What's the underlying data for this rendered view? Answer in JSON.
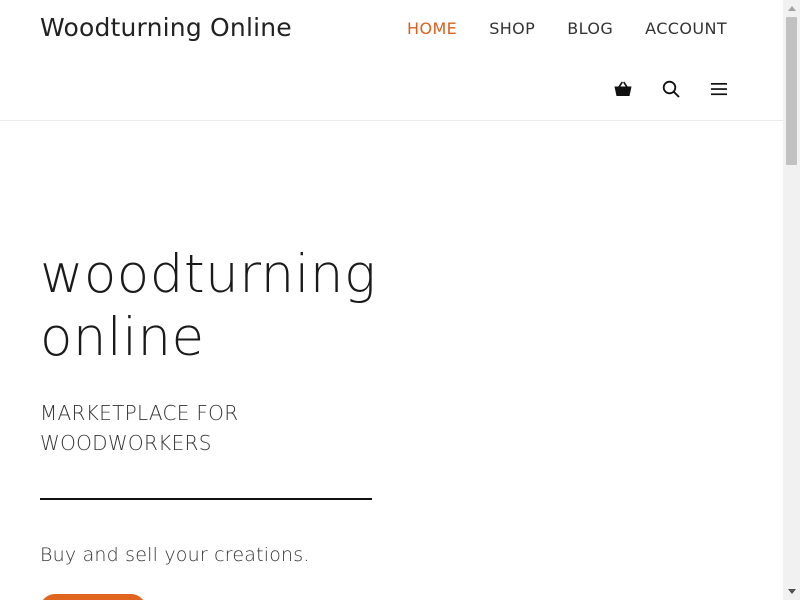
{
  "header": {
    "site_title": "Woodturning Online",
    "nav": [
      {
        "label": "HOME",
        "active": true
      },
      {
        "label": "SHOP",
        "active": false
      },
      {
        "label": "BLOG",
        "active": false
      },
      {
        "label": "ACCOUNT",
        "active": false
      }
    ],
    "icons": [
      "shopping-basket-icon",
      "search-icon",
      "menu-icon"
    ]
  },
  "hero": {
    "title": "woodturning online",
    "subtitle": "MARKETPLACE FOR WOODWORKERS",
    "tagline": "Buy and sell your creations."
  },
  "colors": {
    "accent": "#d9601e",
    "button": "#e0661f",
    "text": "#222222",
    "divider": "#111111"
  }
}
